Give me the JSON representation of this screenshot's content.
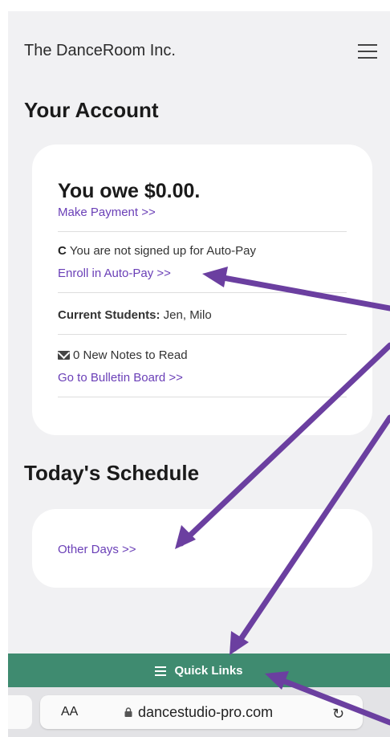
{
  "header": {
    "brand": "The DanceRoom Inc."
  },
  "account": {
    "title": "Your Account",
    "owe_text": "You owe $0.00.",
    "make_payment": "Make Payment >>",
    "autopay_status": "You are not signed up for Auto-Pay",
    "enroll_autopay": "Enroll in Auto-Pay >>",
    "students_label": "Current Students:",
    "students_value": "Jen, Milo",
    "notes_text": "0 New Notes to Read",
    "bulletin_link": "Go to Bulletin Board >>"
  },
  "schedule": {
    "title": "Today's Schedule",
    "other_days": "Other Days >>"
  },
  "quick_links": {
    "label": "Quick Links"
  },
  "browser": {
    "text_size_label": "AA",
    "url": "dancestudio-pro.com"
  },
  "colors": {
    "link": "#6a3fb7",
    "quick_links_bg": "#3f8b70",
    "arrow": "#6b3fa0"
  }
}
